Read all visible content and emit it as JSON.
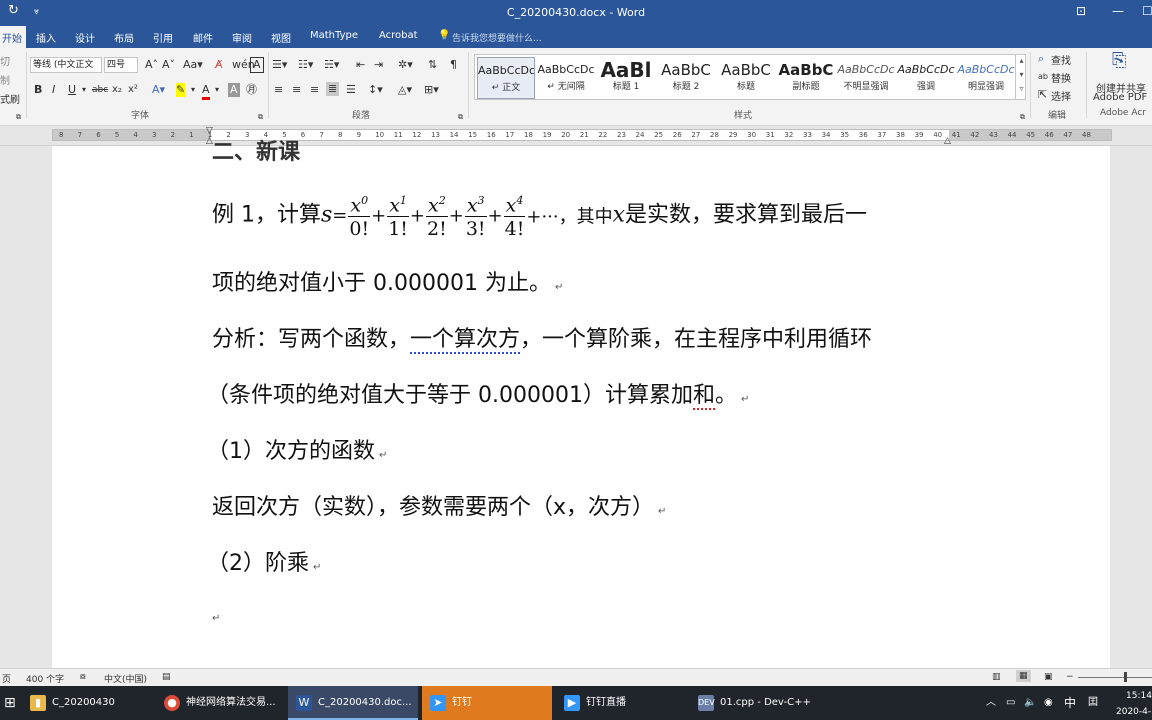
{
  "window": {
    "title": "C_20200430.docx - Word"
  },
  "tabs": [
    "开始",
    "插入",
    "设计",
    "布局",
    "引用",
    "邮件",
    "审阅",
    "视图",
    "MathType",
    "Acrobat"
  ],
  "tell_me": "告诉我您想要做什么...",
  "clipboard": {
    "cut": "切",
    "copy": "制",
    "painter": "式刷"
  },
  "font": {
    "name": "等线 (中文正文",
    "size": "四号",
    "group_label": "字体"
  },
  "paragraph": {
    "group_label": "段落"
  },
  "styles": {
    "group_label": "样式",
    "items": [
      {
        "preview": "AaBbCcDc",
        "name": "↵ 正文",
        "selected": true
      },
      {
        "preview": "AaBbCcDc",
        "name": "↵ 无间隔"
      },
      {
        "preview": "AaBl",
        "name": "标题 1"
      },
      {
        "preview": "AaBbC",
        "name": "标题 2"
      },
      {
        "preview": "AaBbC",
        "name": "标题"
      },
      {
        "preview": "AaBbC",
        "name": "副标题"
      },
      {
        "preview": "AaBbCcDc",
        "name": "不明显强调"
      },
      {
        "preview": "AaBbCcDc",
        "name": "强调"
      },
      {
        "preview": "AaBbCcDc",
        "name": "明显强调"
      }
    ]
  },
  "editing": {
    "find": "查找",
    "replace": "替换",
    "select": "选择",
    "group_label": "编辑"
  },
  "acrobat": {
    "label1": "创建并共享",
    "label2": "Adobe PDF",
    "group_label": "Adobe Acr"
  },
  "ruler_numbers": [
    "8",
    "7",
    "6",
    "5",
    "4",
    "3",
    "2",
    "1",
    "1",
    "2",
    "3",
    "4",
    "5",
    "6",
    "7",
    "8",
    "9",
    "10",
    "11",
    "12",
    "13",
    "14",
    "15",
    "16",
    "17",
    "18",
    "19",
    "20",
    "21",
    "22",
    "23",
    "24",
    "25",
    "26",
    "27",
    "28",
    "29",
    "30",
    "31",
    "32",
    "33",
    "34",
    "35",
    "36",
    "37",
    "38",
    "39",
    "40",
    "41",
    "42",
    "43",
    "44",
    "45",
    "46",
    "47",
    "48"
  ],
  "doc": {
    "heading_partial": "二、新课",
    "ex1_prefix": "例 1，计算",
    "ex1_var": "s",
    "fractions": [
      {
        "num": "x",
        "exp": "0",
        "den": "0!"
      },
      {
        "num": "x",
        "exp": "1",
        "den": "1!"
      },
      {
        "num": "x",
        "exp": "2",
        "den": "2!"
      },
      {
        "num": "x",
        "exp": "3",
        "den": "3!"
      },
      {
        "num": "x",
        "exp": "4",
        "den": "4!"
      }
    ],
    "ex1_tail": "+···，其中",
    "ex1_x": "x",
    "ex1_end": "是实数，要求算到最后一",
    "line2": "项的绝对值小于 0.000001 为止。",
    "analysis_a": "分析：写两个函数，",
    "analysis_b": "一个算次方",
    "analysis_c": "，一个算阶乘，在主程序中利用循环",
    "line4_a": "（条件项的绝对值大于等于 0.000001）计算累加",
    "line4_b": "和",
    "line4_c": "。",
    "line5": "（1）次方的函数",
    "line6": "返回次方（实数），参数需要两个（x，次方）",
    "line7": "（2）阶乘",
    "para_mark": "↵"
  },
  "status": {
    "page": "页",
    "words": "400 个字",
    "lang": "中文(中国)"
  },
  "taskbar": {
    "items": [
      "C_20200430",
      "神经网络算法交易...",
      "C_20200430.doc...",
      "钉钉",
      "钉钉直播",
      "01.cpp - Dev-C++"
    ],
    "time": "15:14",
    "date": "2020-4-",
    "ime": "中"
  }
}
